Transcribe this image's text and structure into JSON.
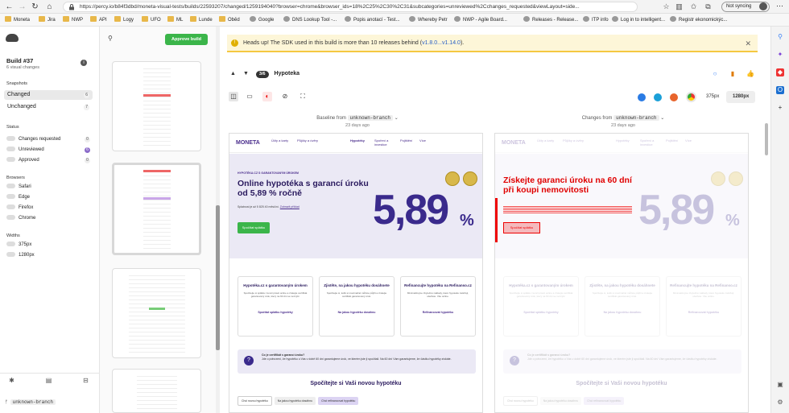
{
  "browser": {
    "url": "https://percy.io/b84f3dbd/moneta-visual-tests/builds/22593207/changed/1259194040?browser=chrome&browser_ids=18%2C25%2C30%2C31&subcategories=unreviewed%2Cchanges_requested&viewLayout=side...",
    "sync_label": "Not syncing",
    "bookmarks": [
      "Moneta",
      "Jira",
      "NWP",
      "API",
      "Logy",
      "UFO",
      "ML",
      "Lunde",
      "Oběd",
      "Google",
      "DNS Lookup Tool -...",
      "Popis anotací - Test...",
      "Whereby Petr",
      "NWP - Agile Board...",
      "Releases - Release...",
      "ITP info",
      "Log in to intelligent...",
      "Registr ekonomickýc..."
    ]
  },
  "sidebar": {
    "build_title": "Build #37",
    "build_sub": "6 visual changes",
    "snapshots_title": "Snapshots",
    "changed_label": "Changed",
    "changed_count": "6",
    "unchanged_label": "Unchanged",
    "unchanged_count": "7",
    "status_title": "Status",
    "status": [
      {
        "label": "Changes requested",
        "count": "0"
      },
      {
        "label": "Unreviewed",
        "count": "6"
      },
      {
        "label": "Approved",
        "count": "0"
      }
    ],
    "browsers_title": "Browsers",
    "browsers": [
      "Safari",
      "Edge",
      "Firefox",
      "Chrome"
    ],
    "widths_title": "Widths",
    "widths": [
      "375px",
      "1280px"
    ],
    "branch": "unknown-branch"
  },
  "thumbs": {
    "approve_label": "Approve build"
  },
  "main": {
    "alert_prefix": "Heads up! The SDK used in this build is more than 10 releases behind (",
    "alert_versions": "v1.8.0...v1.14.0",
    "alert_suffix": ").",
    "pager": "3/6",
    "snapshot_name": "Hypoteka",
    "width_375": "375px",
    "width_1280": "1280px",
    "baseline_label": "Baseline from",
    "baseline_branch": "unknown-branch",
    "baseline_age": "23 days ago",
    "changes_label": "Changes from",
    "changes_branch": "unknown-branch",
    "changes_age": "23 days ago"
  },
  "site": {
    "logo": "MONETA",
    "menu": [
      "Účty a karty",
      "Půjčky a úvěry",
      "Hypotéky",
      "Spoření a investice",
      "Pojištění",
      "Více"
    ],
    "eyebrow": "HYPOTÉKA.CZ S GARANTOVANÝM ÚROKEM",
    "headline": "Online hypotéka s garancí úroku od 5,89 % ročně",
    "small": "Splatnost je až 5 825 40 měsíční.",
    "small_link": "Zobrazit příklad",
    "cta": "Spočítat splátku",
    "big_rate": "5,89",
    "big_pct": "%",
    "cards": [
      {
        "title": "Hypotéka.cz s garantovaným úrokem",
        "text": "Spočítejte si splátku i konci právě online a získejte certifikát garantovaný úrok, který na 60 dní se nezvýší.",
        "link": "Spočítat splátku hypotéky"
      },
      {
        "title": "Zjistěte, na jakou hypotéku dosáhnete",
        "text": "Spočítejte si, kolik si maximálně můžete půjčit a získejte certifikát garantovaný úrok.",
        "link": "Na jakou hypotéku dosáhnu"
      },
      {
        "title": "Refinancujte hypotéku na Refinanso.cz",
        "text": "Minimalizujme zbytečné náklady, které hypotéku zatěžují, ušetřete. Vše online.",
        "link": "Refinancovat hypotéku"
      }
    ],
    "info_title": "Co je certifikát s garancí úroku?",
    "info_text": "Jde o potvrzení, že hypotéku u Vás v době 60 dní garantujeme úrok, ve kterém jste ji spočítali. Na 60 dní Vám garantujeme, že částku hypotéky získáte.",
    "calc_title": "Spočítejte si Vaši novou hypotéku",
    "tabs": [
      "Chci novou hypotéku",
      "Na jakou hypotéku dosáhnu",
      "Chci refinancovat hypotéku"
    ],
    "diff_headline": "Získejte garanci úroku na 60 dní při koupi nemovitosti",
    "diff_cta": "Spočítat splátku"
  },
  "colors": {
    "approve": "#3bb54a",
    "alert_bg": "#fdf6d8",
    "alert_border": "#f5c842",
    "diff": "#e00000",
    "brand": "#3a2a8c"
  }
}
